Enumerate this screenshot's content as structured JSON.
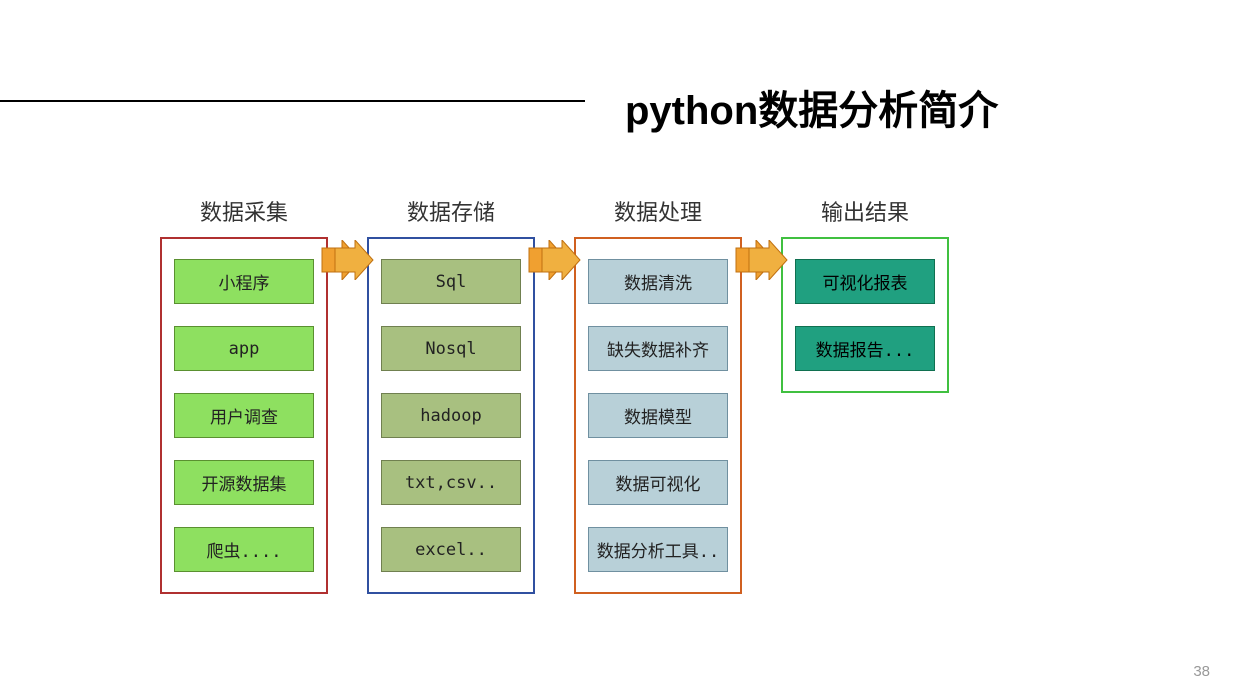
{
  "title": "python数据分析简介",
  "columns": [
    {
      "title": "数据采集",
      "items": [
        "小程序",
        "app",
        "用户调查",
        "开源数据集",
        "爬虫...."
      ]
    },
    {
      "title": "数据存储",
      "items": [
        "Sql",
        "Nosql",
        "hadoop",
        "txt,csv..",
        "excel.."
      ]
    },
    {
      "title": "数据处理",
      "items": [
        "数据清洗",
        "缺失数据补齐",
        "数据模型",
        "数据可视化",
        "数据分析工具.."
      ]
    },
    {
      "title": "输出结果",
      "items": [
        "可视化报表",
        "数据报告..."
      ]
    }
  ],
  "pageNumber": "38"
}
